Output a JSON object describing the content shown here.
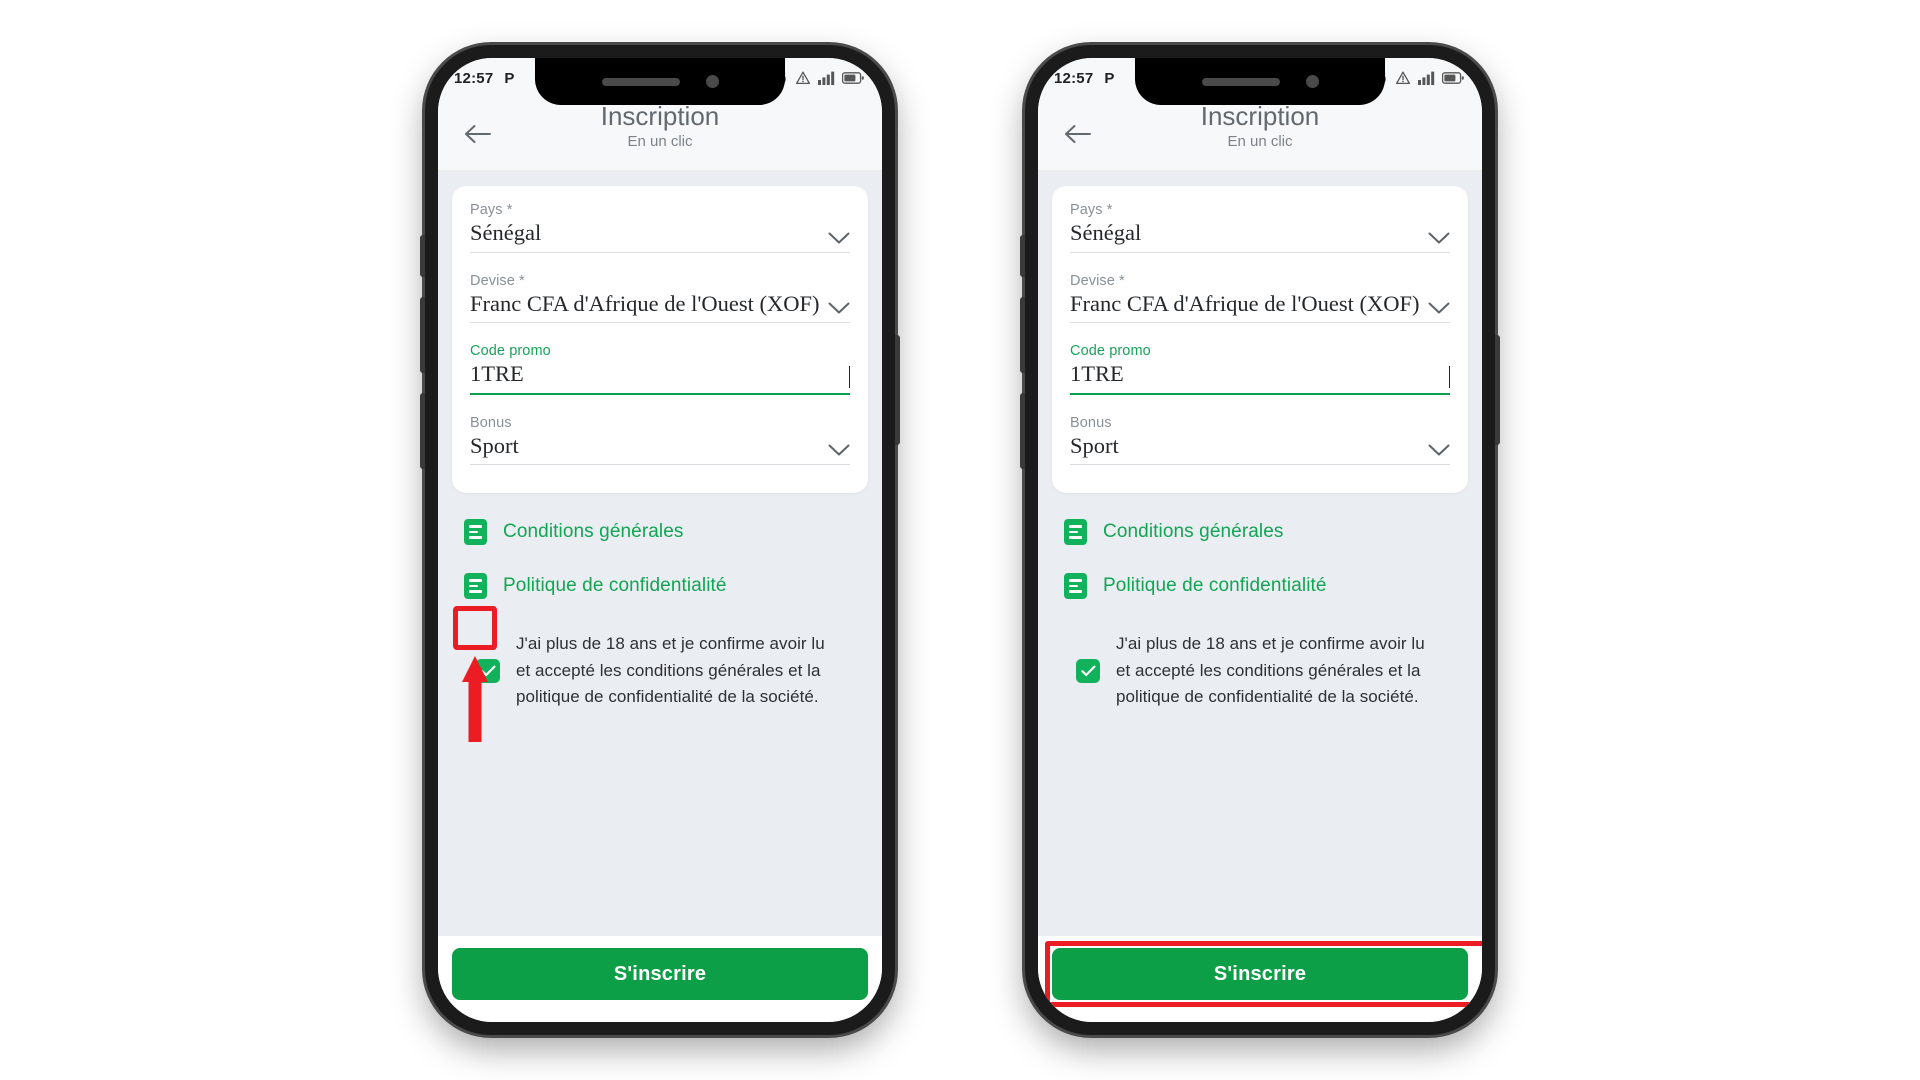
{
  "colors": {
    "brand_green": "#0d9f47",
    "icon_green": "#12b25c",
    "link_green": "#12a553",
    "annotation_red": "#ec1c24",
    "screen_bg": "#eaedf2",
    "header_bg": "#f7f8fa"
  },
  "status_bar": {
    "time": "12:57",
    "network_badge": "P",
    "icons": [
      "alarm-icon",
      "warning-icon",
      "signal-icon",
      "battery-icon"
    ]
  },
  "header": {
    "back_icon": "back-arrow-icon",
    "title": "Inscription",
    "subtitle": "En un clic"
  },
  "form": {
    "fields": [
      {
        "label": "Pays *",
        "value": "Sénégal",
        "type": "select",
        "accent": false,
        "caret": false
      },
      {
        "label": "Devise *",
        "value": "Franc CFA d'Afrique de l'Ouest (XOF)",
        "type": "select",
        "accent": false,
        "caret": false
      },
      {
        "label": "Code promo",
        "value": "1TRE",
        "type": "text",
        "accent": true,
        "caret": true
      },
      {
        "label": "Bonus",
        "value": "Sport",
        "type": "select",
        "accent": false,
        "caret": false
      }
    ]
  },
  "legal_links": [
    {
      "label": "Conditions générales",
      "icon": "document-icon"
    },
    {
      "label": "Politique de confidentialité",
      "icon": "document-icon"
    }
  ],
  "consent": {
    "checked": true,
    "text": "J'ai plus de 18 ans et je confirme avoir lu et accepté les conditions générales et la politique de confidentialité de la société."
  },
  "footer": {
    "submit_label": "S'inscrire"
  },
  "annotations": {
    "left_phone": [
      "checkbox-highlight-box",
      "upward-arrow"
    ],
    "right_phone": [
      "submit-button-highlight-box"
    ]
  }
}
